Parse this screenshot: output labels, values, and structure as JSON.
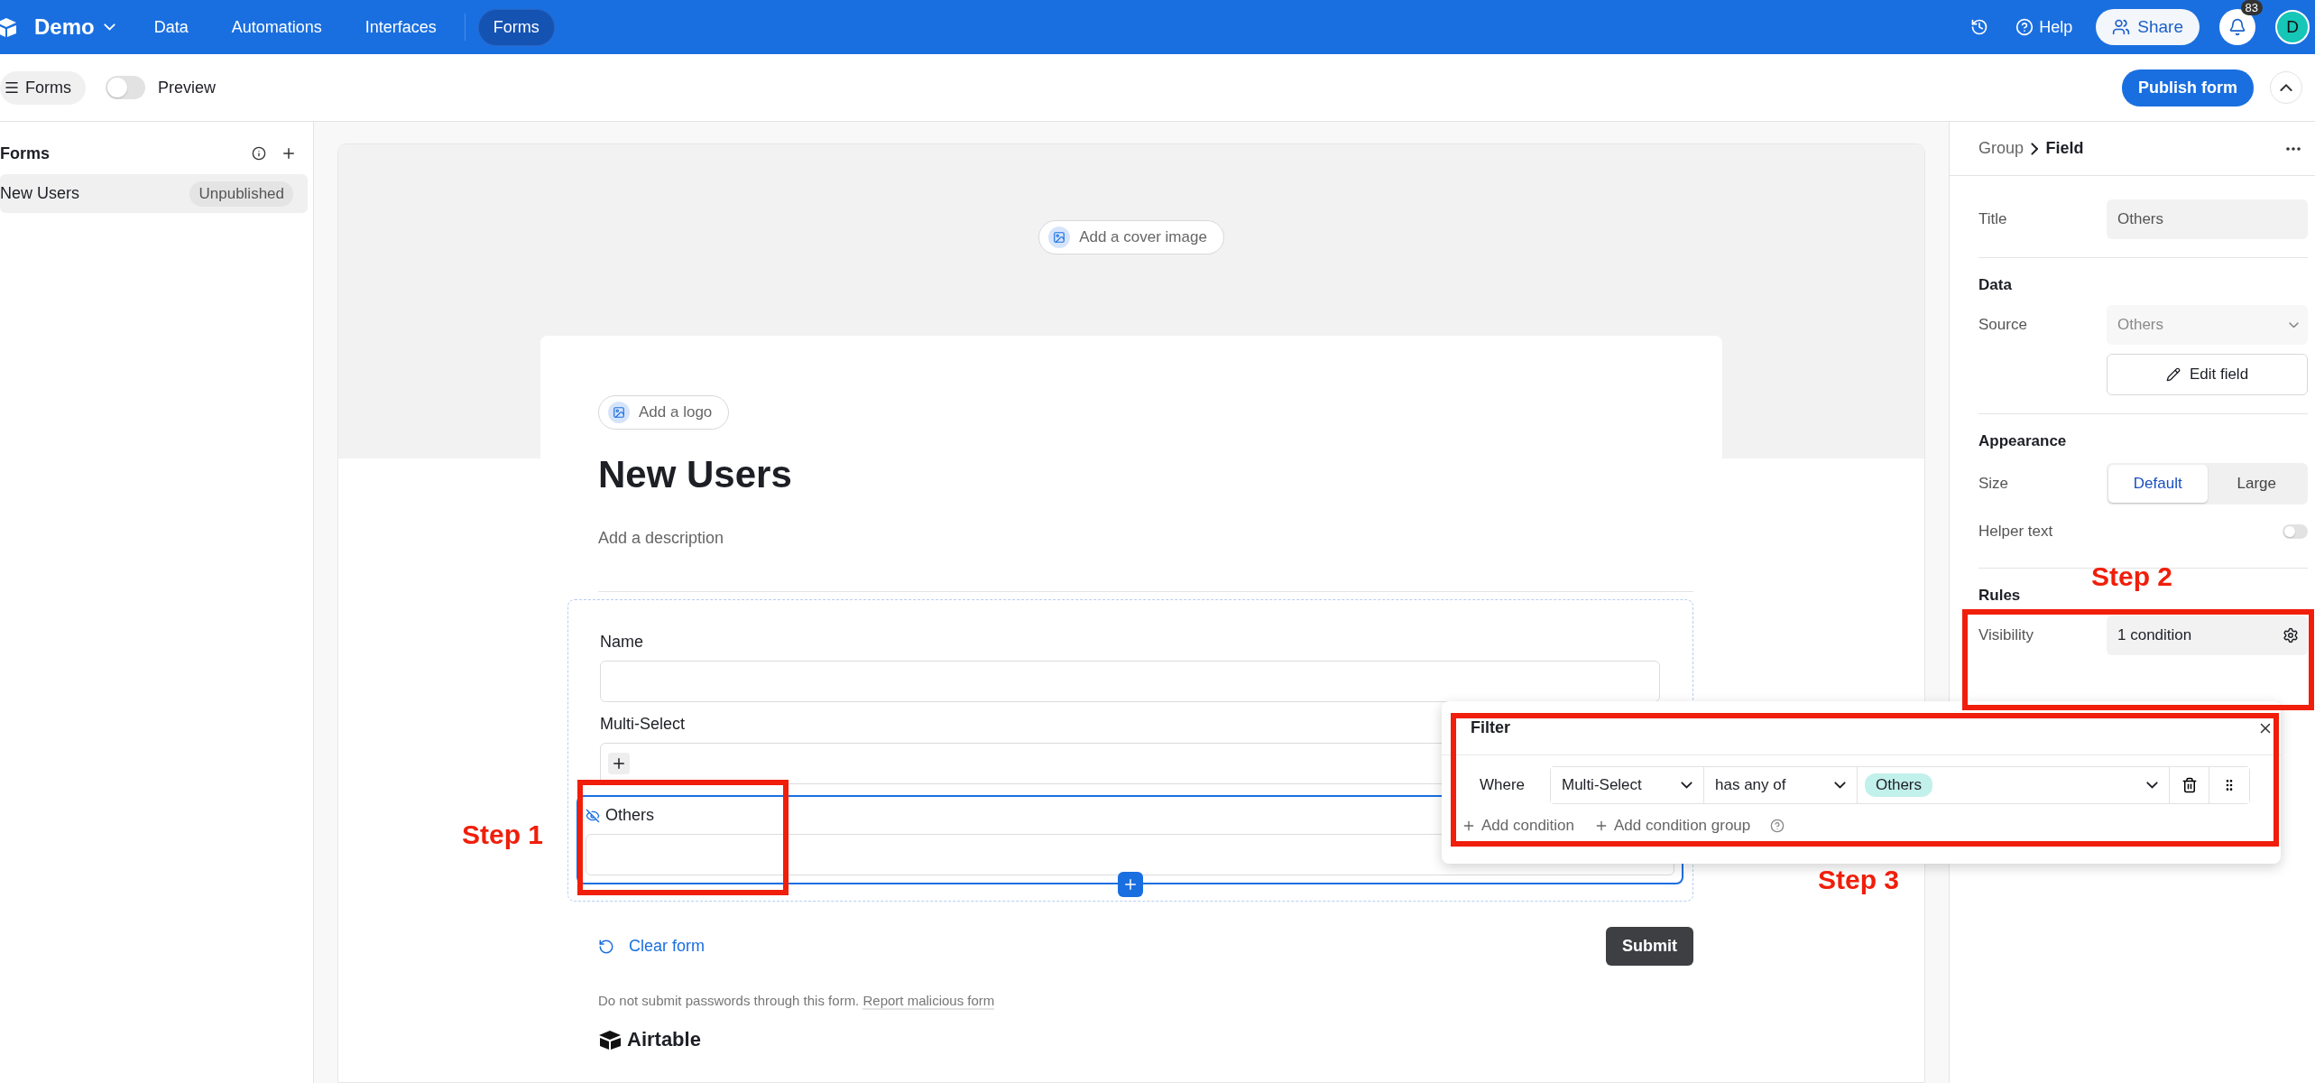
{
  "topbar": {
    "base_name": "Demo",
    "nav": [
      {
        "label": "Data",
        "selected": false
      },
      {
        "label": "Automations",
        "selected": false
      },
      {
        "label": "Interfaces",
        "selected": false
      },
      {
        "label": "Forms",
        "selected": true
      }
    ],
    "help": "Help",
    "share": "Share",
    "notification_count": "83",
    "avatar": "D"
  },
  "toolbar": {
    "forms_button": "Forms",
    "preview": {
      "label": "Preview",
      "on": false
    },
    "publish": "Publish form"
  },
  "sidebar": {
    "title": "Forms",
    "items": [
      {
        "name": "New Users",
        "status": "Unpublished",
        "selected": true
      }
    ]
  },
  "form": {
    "cover_button": "Add a cover image",
    "logo_button": "Add a logo",
    "title": "New Users",
    "description_placeholder": "Add a description",
    "fields": [
      {
        "label": "Name",
        "kind": "text",
        "hidden": false,
        "selected": false
      },
      {
        "label": "Multi-Select",
        "kind": "multiselect",
        "hidden": false,
        "selected": false
      },
      {
        "label": "Others",
        "kind": "text",
        "hidden": true,
        "selected": true
      }
    ],
    "clear": "Clear form",
    "submit": "Submit",
    "disclaimer": "Do not submit passwords through this form.",
    "report_link": "Report malicious form",
    "brand": "Airtable"
  },
  "panel": {
    "breadcrumb": [
      "Group",
      "Field"
    ],
    "title": {
      "label": "Title",
      "value": "Others"
    },
    "data_heading": "Data",
    "source": {
      "label": "Source",
      "value": "Others",
      "disabled": true
    },
    "edit_field": "Edit field",
    "appearance_heading": "Appearance",
    "size": {
      "label": "Size",
      "options": [
        {
          "label": "Default",
          "selected": true
        },
        {
          "label": "Large",
          "selected": false
        }
      ]
    },
    "helper_text": {
      "label": "Helper text",
      "on": false
    },
    "rules_heading": "Rules",
    "visibility": {
      "label": "Visibility",
      "value": "1 condition"
    }
  },
  "filter_popup": {
    "title": "Filter",
    "conditions": [
      {
        "prefix": "Where",
        "field": "Multi-Select",
        "operator": "has any of",
        "values": [
          "Others"
        ]
      }
    ],
    "add_condition": "Add condition",
    "add_group": "Add condition group"
  },
  "annotations": [
    {
      "label": "Step 1"
    },
    {
      "label": "Step 2"
    },
    {
      "label": "Step 3"
    }
  ]
}
